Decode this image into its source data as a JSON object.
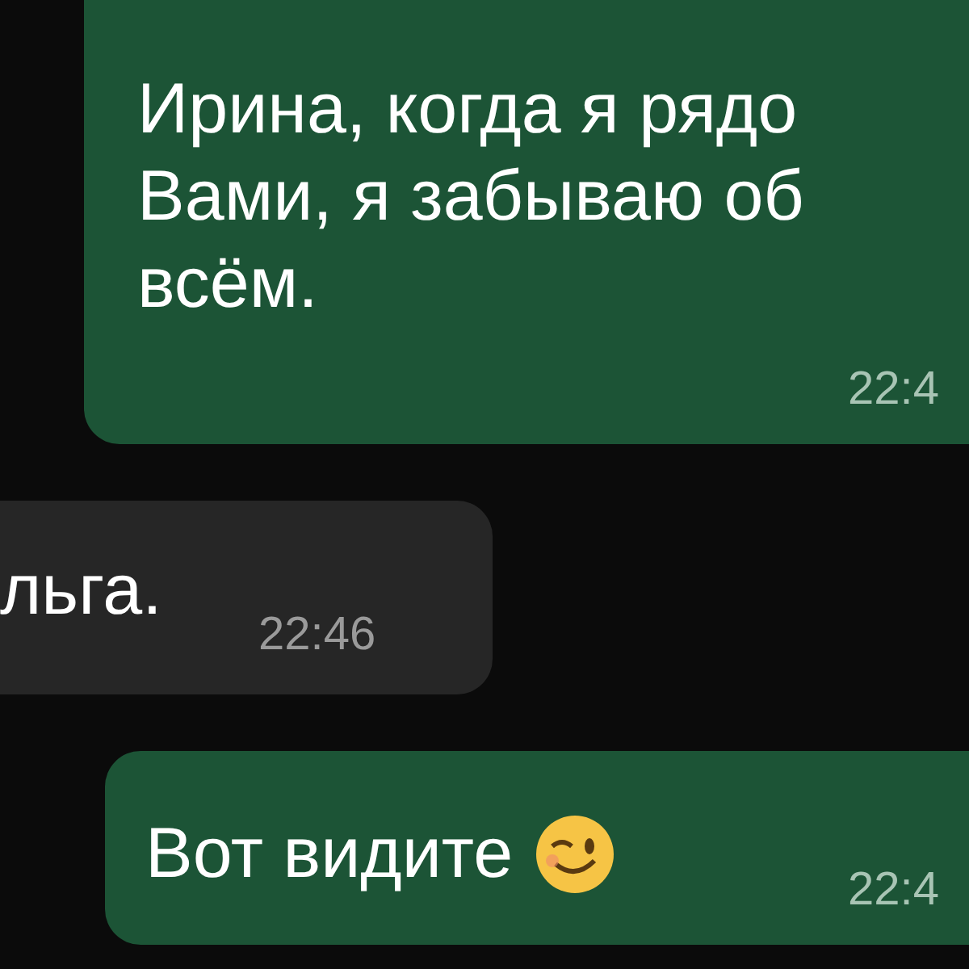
{
  "messages": [
    {
      "kind": "sent",
      "lines": [
        "Ирина, когда я рядо",
        "Вами, я забываю об",
        "всём."
      ],
      "time": "22:4"
    },
    {
      "kind": "received",
      "lines": [
        "льга."
      ],
      "time": "22:46"
    },
    {
      "kind": "sent",
      "lines": [
        "Вот видите"
      ],
      "winking_emoji": true,
      "time": "22:4"
    }
  ]
}
